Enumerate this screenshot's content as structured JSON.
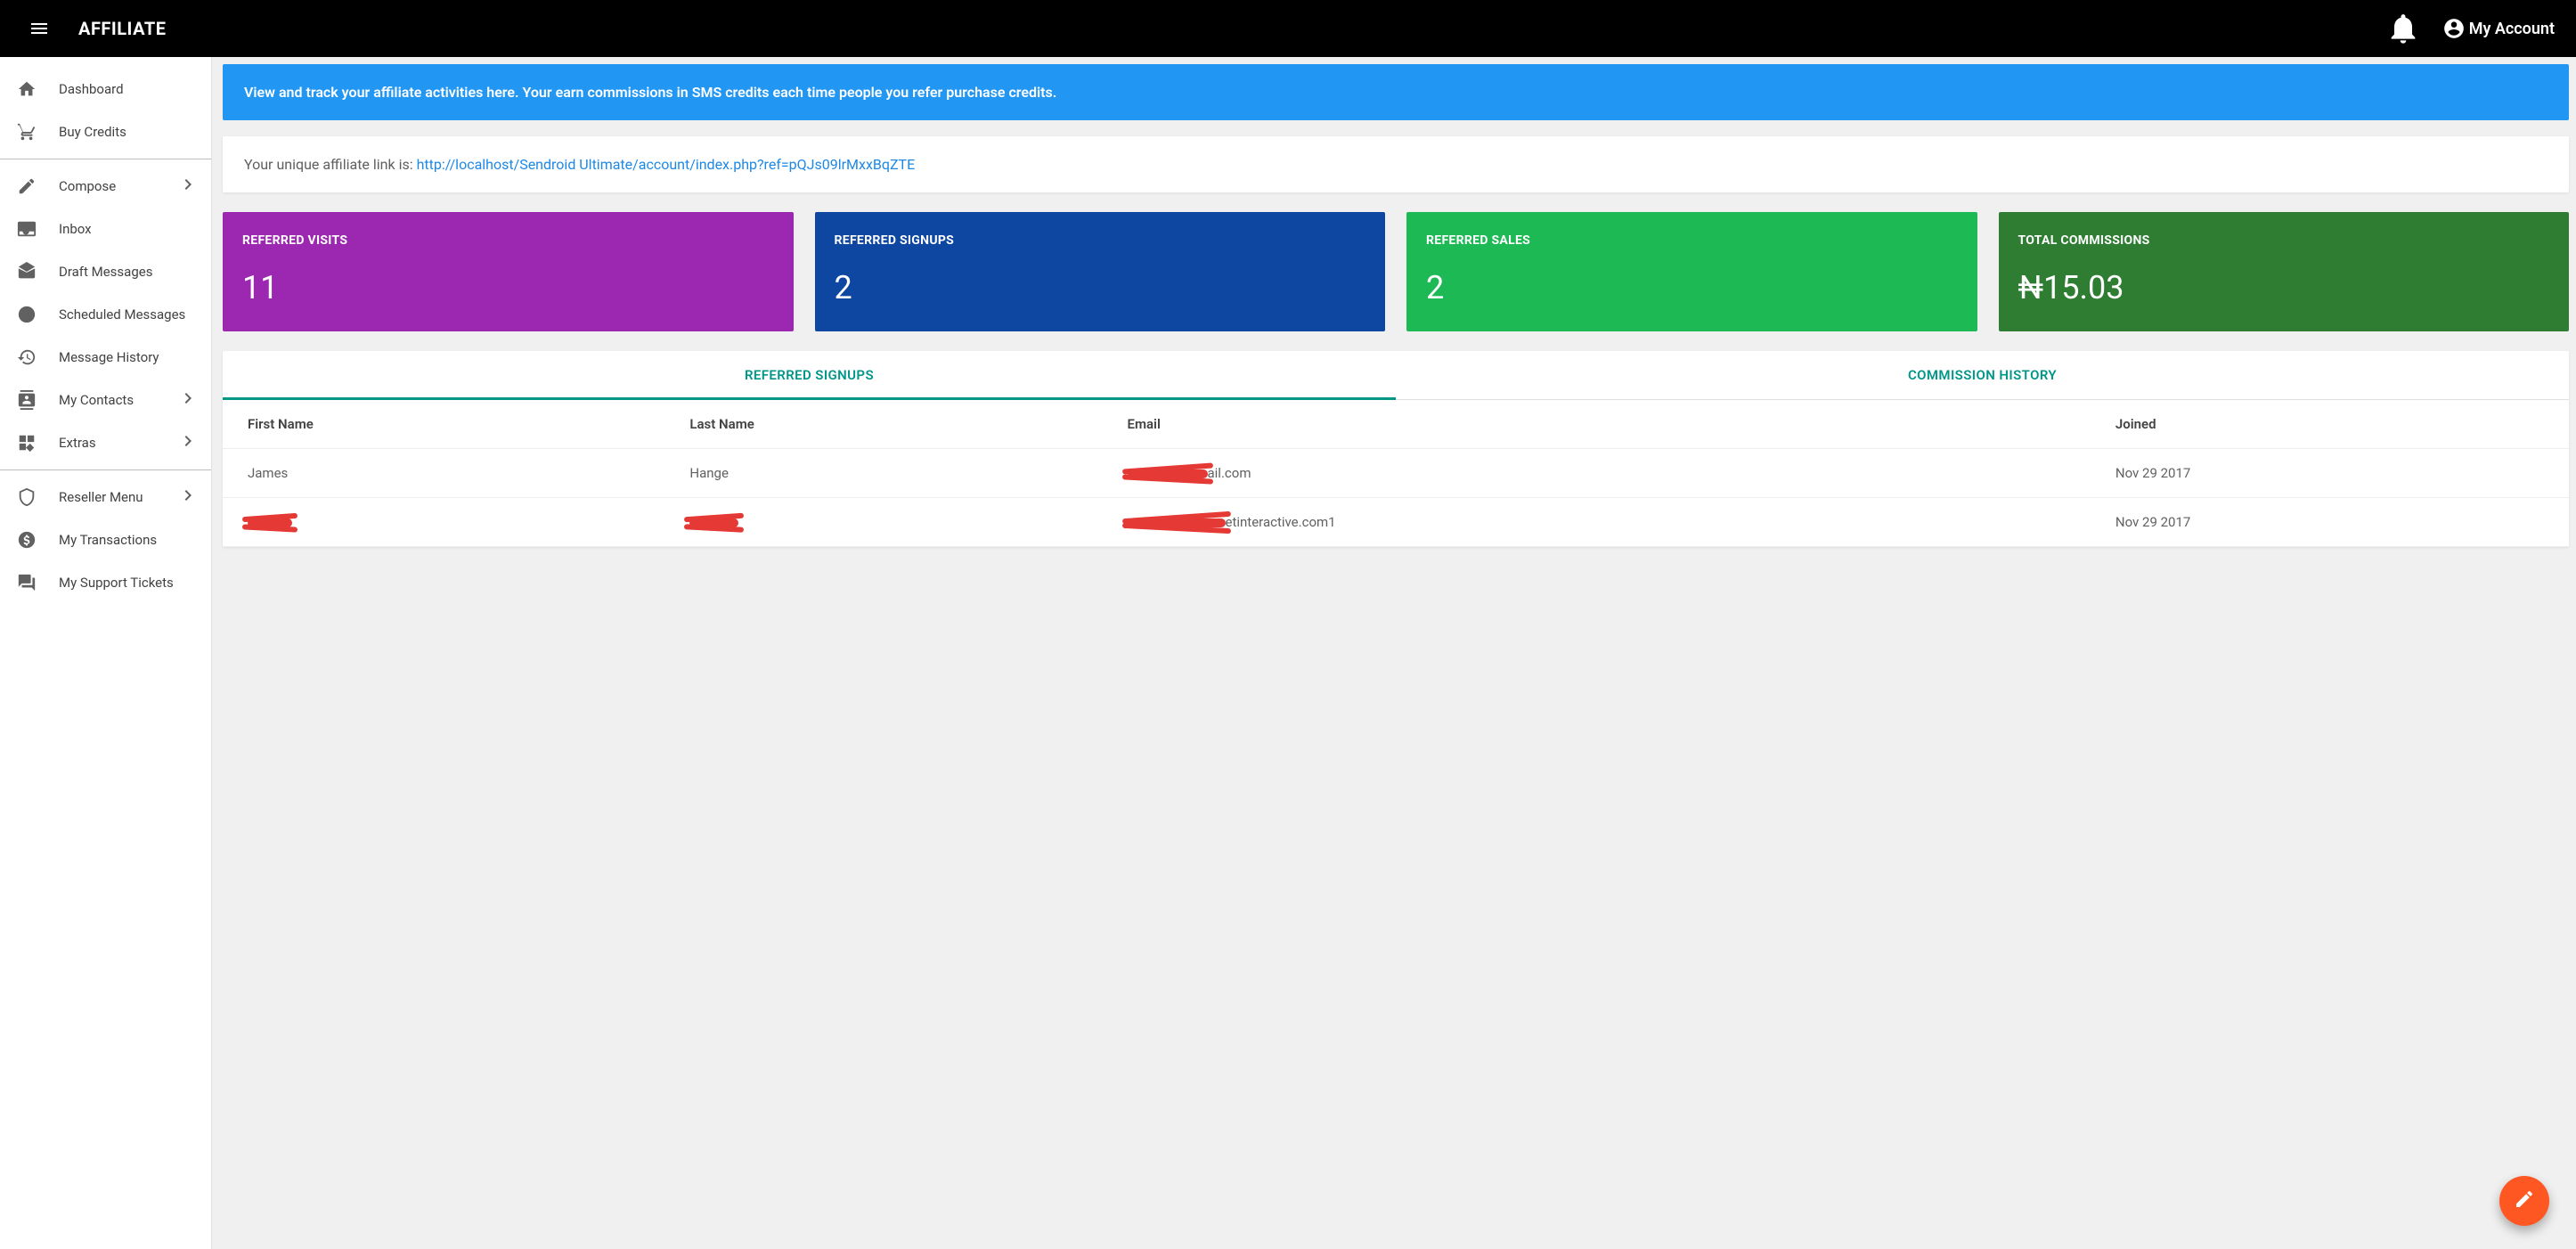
{
  "appbar": {
    "title": "AFFILIATE",
    "account_label": "My Account"
  },
  "sidebar": {
    "items": [
      {
        "label": "Dashboard",
        "icon": "home",
        "expandable": false
      },
      {
        "label": "Buy Credits",
        "icon": "cart",
        "expandable": false
      },
      {
        "label": "Compose",
        "icon": "pencil",
        "expandable": true
      },
      {
        "label": "Inbox",
        "icon": "inbox",
        "expandable": false
      },
      {
        "label": "Draft Messages",
        "icon": "drafts",
        "expandable": false
      },
      {
        "label": "Scheduled Messages",
        "icon": "clock",
        "expandable": false
      },
      {
        "label": "Message History",
        "icon": "history",
        "expandable": false
      },
      {
        "label": "My Contacts",
        "icon": "contacts",
        "expandable": true
      },
      {
        "label": "Extras",
        "icon": "widgets",
        "expandable": true
      },
      {
        "label": "Reseller Menu",
        "icon": "shield",
        "expandable": true
      },
      {
        "label": "My Transactions",
        "icon": "money",
        "expandable": false
      },
      {
        "label": "My Support Tickets",
        "icon": "chat",
        "expandable": false
      }
    ]
  },
  "banner": {
    "text": "View and track your affiliate activities here. Your earn commissions in SMS credits each time people you refer purchase credits."
  },
  "affiliate_link": {
    "prefix": "Your unique affiliate link is: ",
    "url": "http://localhost/Sendroid Ultimate/account/index.php?ref=pQJs09lrMxxBqZTE"
  },
  "stats": {
    "visits": {
      "label": "REFERRED VISITS",
      "value": "11",
      "color": "#9c27b0"
    },
    "signups": {
      "label": "REFERRED SIGNUPS",
      "value": "2",
      "color": "#0d47a1"
    },
    "sales": {
      "label": "REFERRED SALES",
      "value": "2",
      "color": "#1db954"
    },
    "commissions": {
      "label": "TOTAL COMMISSIONS",
      "value": "₦15.03",
      "color": "#2e7d32"
    }
  },
  "tabs": {
    "active": 0,
    "items": [
      {
        "label": "REFERRED SIGNUPS"
      },
      {
        "label": "COMMISSION HISTORY"
      }
    ]
  },
  "table": {
    "columns": [
      "First Name",
      "Last Name",
      "Email",
      "Joined"
    ],
    "rows": [
      {
        "first_name": "James",
        "last_name": "Hange",
        "email_suffix": "ail.com",
        "email_redacted": true,
        "joined": "Nov 29 2017",
        "first_redacted": false,
        "last_redacted": false
      },
      {
        "first_name": "",
        "last_name": "",
        "email_suffix": "etinteractive.com1",
        "email_redacted": true,
        "joined": "Nov 29 2017",
        "first_redacted": true,
        "last_redacted": true
      }
    ]
  },
  "colors": {
    "accent": "#009688",
    "fab": "#ff5722",
    "banner": "#2196f3",
    "link": "#1e88e5"
  }
}
